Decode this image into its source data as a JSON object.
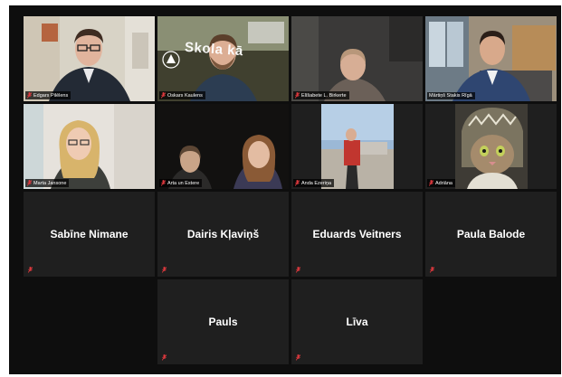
{
  "meeting": {
    "accent_active": "#e9e66b",
    "muted_icon_color": "#e0393e"
  },
  "participants": [
    {
      "name": "Edgars Pilēlens",
      "display": "video",
      "muted": true
    },
    {
      "name": "Oskars Kaulens",
      "display": "video",
      "muted": true,
      "background_text": "Skola kā"
    },
    {
      "name": "Elīšabete L. Birkerte",
      "display": "video",
      "muted": true
    },
    {
      "name": "Mārtiņš Stakis Rīgā",
      "display": "video",
      "muted": false,
      "active_speaker": true
    },
    {
      "name": "Marta Jansone",
      "display": "video",
      "muted": true
    },
    {
      "name": "Arta un Estere",
      "display": "video",
      "muted": true
    },
    {
      "name": "Anda Ezeriņa",
      "display": "video",
      "muted": true
    },
    {
      "name": "Adriāna",
      "display": "video",
      "muted": true
    },
    {
      "name": "Sabīne Nimane",
      "display": "name",
      "muted": true
    },
    {
      "name": "Dairis Kļaviņš",
      "display": "name",
      "muted": true
    },
    {
      "name": "Eduards Veitners",
      "display": "name",
      "muted": true
    },
    {
      "name": "Paula Balode",
      "display": "name",
      "muted": true
    },
    {
      "name": "Pauls",
      "display": "name",
      "muted": true
    },
    {
      "name": "Līva",
      "display": "name",
      "muted": true
    }
  ]
}
